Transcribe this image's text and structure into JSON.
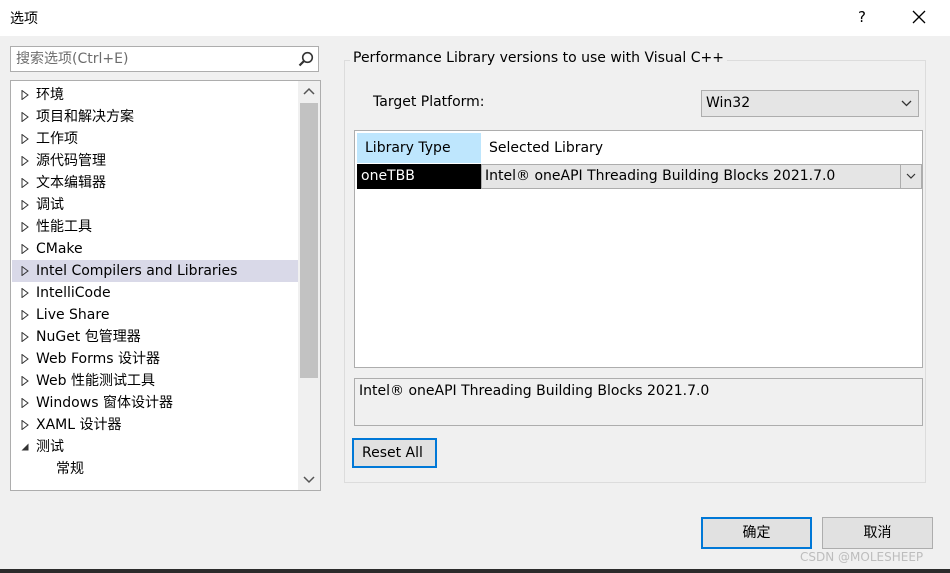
{
  "window": {
    "title": "选项",
    "help_label": "?"
  },
  "search": {
    "placeholder": "搜索选项(Ctrl+E)"
  },
  "tree": {
    "items": [
      {
        "label": "环境",
        "state": "collapsed"
      },
      {
        "label": "项目和解决方案",
        "state": "collapsed"
      },
      {
        "label": "工作项",
        "state": "collapsed"
      },
      {
        "label": "源代码管理",
        "state": "collapsed"
      },
      {
        "label": "文本编辑器",
        "state": "collapsed"
      },
      {
        "label": "调试",
        "state": "collapsed"
      },
      {
        "label": "性能工具",
        "state": "collapsed"
      },
      {
        "label": "CMake",
        "state": "collapsed"
      },
      {
        "label": "Intel Compilers and Libraries",
        "state": "collapsed",
        "selected": true
      },
      {
        "label": "IntelliCode",
        "state": "collapsed"
      },
      {
        "label": "Live Share",
        "state": "collapsed"
      },
      {
        "label": "NuGet 包管理器",
        "state": "collapsed"
      },
      {
        "label": "Web Forms 设计器",
        "state": "collapsed"
      },
      {
        "label": "Web 性能测试工具",
        "state": "collapsed"
      },
      {
        "label": "Windows 窗体设计器",
        "state": "collapsed"
      },
      {
        "label": "XAML 设计器",
        "state": "collapsed"
      },
      {
        "label": "测试",
        "state": "expanded"
      },
      {
        "label": "常规",
        "state": "child"
      }
    ]
  },
  "panel": {
    "group_title": "Performance Library versions to use with Visual C++",
    "platform_label": "Target Platform:",
    "platform_value": "Win32",
    "table": {
      "headers": [
        "Library Type",
        "Selected Library"
      ],
      "rows": [
        {
          "type": "oneTBB",
          "selected": "Intel® oneAPI Threading Building Blocks 2021.7.0"
        }
      ]
    },
    "description": "Intel® oneAPI Threading Building Blocks 2021.7.0",
    "reset_label": "Reset All"
  },
  "footer": {
    "ok_label": "确定",
    "cancel_label": "取消",
    "watermark": "CSDN @MOLESHEEP"
  },
  "colors": {
    "accent": "#0078d7",
    "header_highlight": "#bee6fd",
    "selected_tree": "#d9d9e8"
  },
  "icons": {
    "search": "search-icon",
    "close": "close-icon",
    "chevron": "chevron-down-icon",
    "tree_arrow": "triangle-right-icon"
  }
}
